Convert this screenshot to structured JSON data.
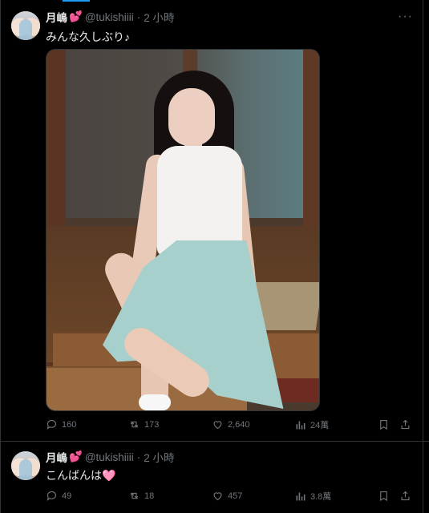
{
  "tweets": [
    {
      "name": "月嶋",
      "emoji": "💕",
      "handle": "@tukishiiii",
      "time": "2 小時",
      "text": "みんな久しぶり♪",
      "replies": "160",
      "retweets": "173",
      "likes": "2,640",
      "views": "24萬"
    },
    {
      "name": "月嶋",
      "emoji": "💕",
      "handle": "@tukishiiii",
      "time": "2 小時",
      "text": "こんばんは🩷",
      "replies": "49",
      "retweets": "18",
      "likes": "457",
      "views": "3.8萬"
    }
  ],
  "ui": {
    "more": "···",
    "dot": "·"
  },
  "icons": [
    "reply-icon",
    "retweet-icon",
    "like-icon",
    "views-icon",
    "bookmark-icon",
    "share-icon",
    "more-icon"
  ],
  "colors": {
    "background": "#000000",
    "text": "#e7e9ea",
    "muted": "#71767b",
    "border": "#2f3336",
    "accent": "#1d9bf0"
  }
}
